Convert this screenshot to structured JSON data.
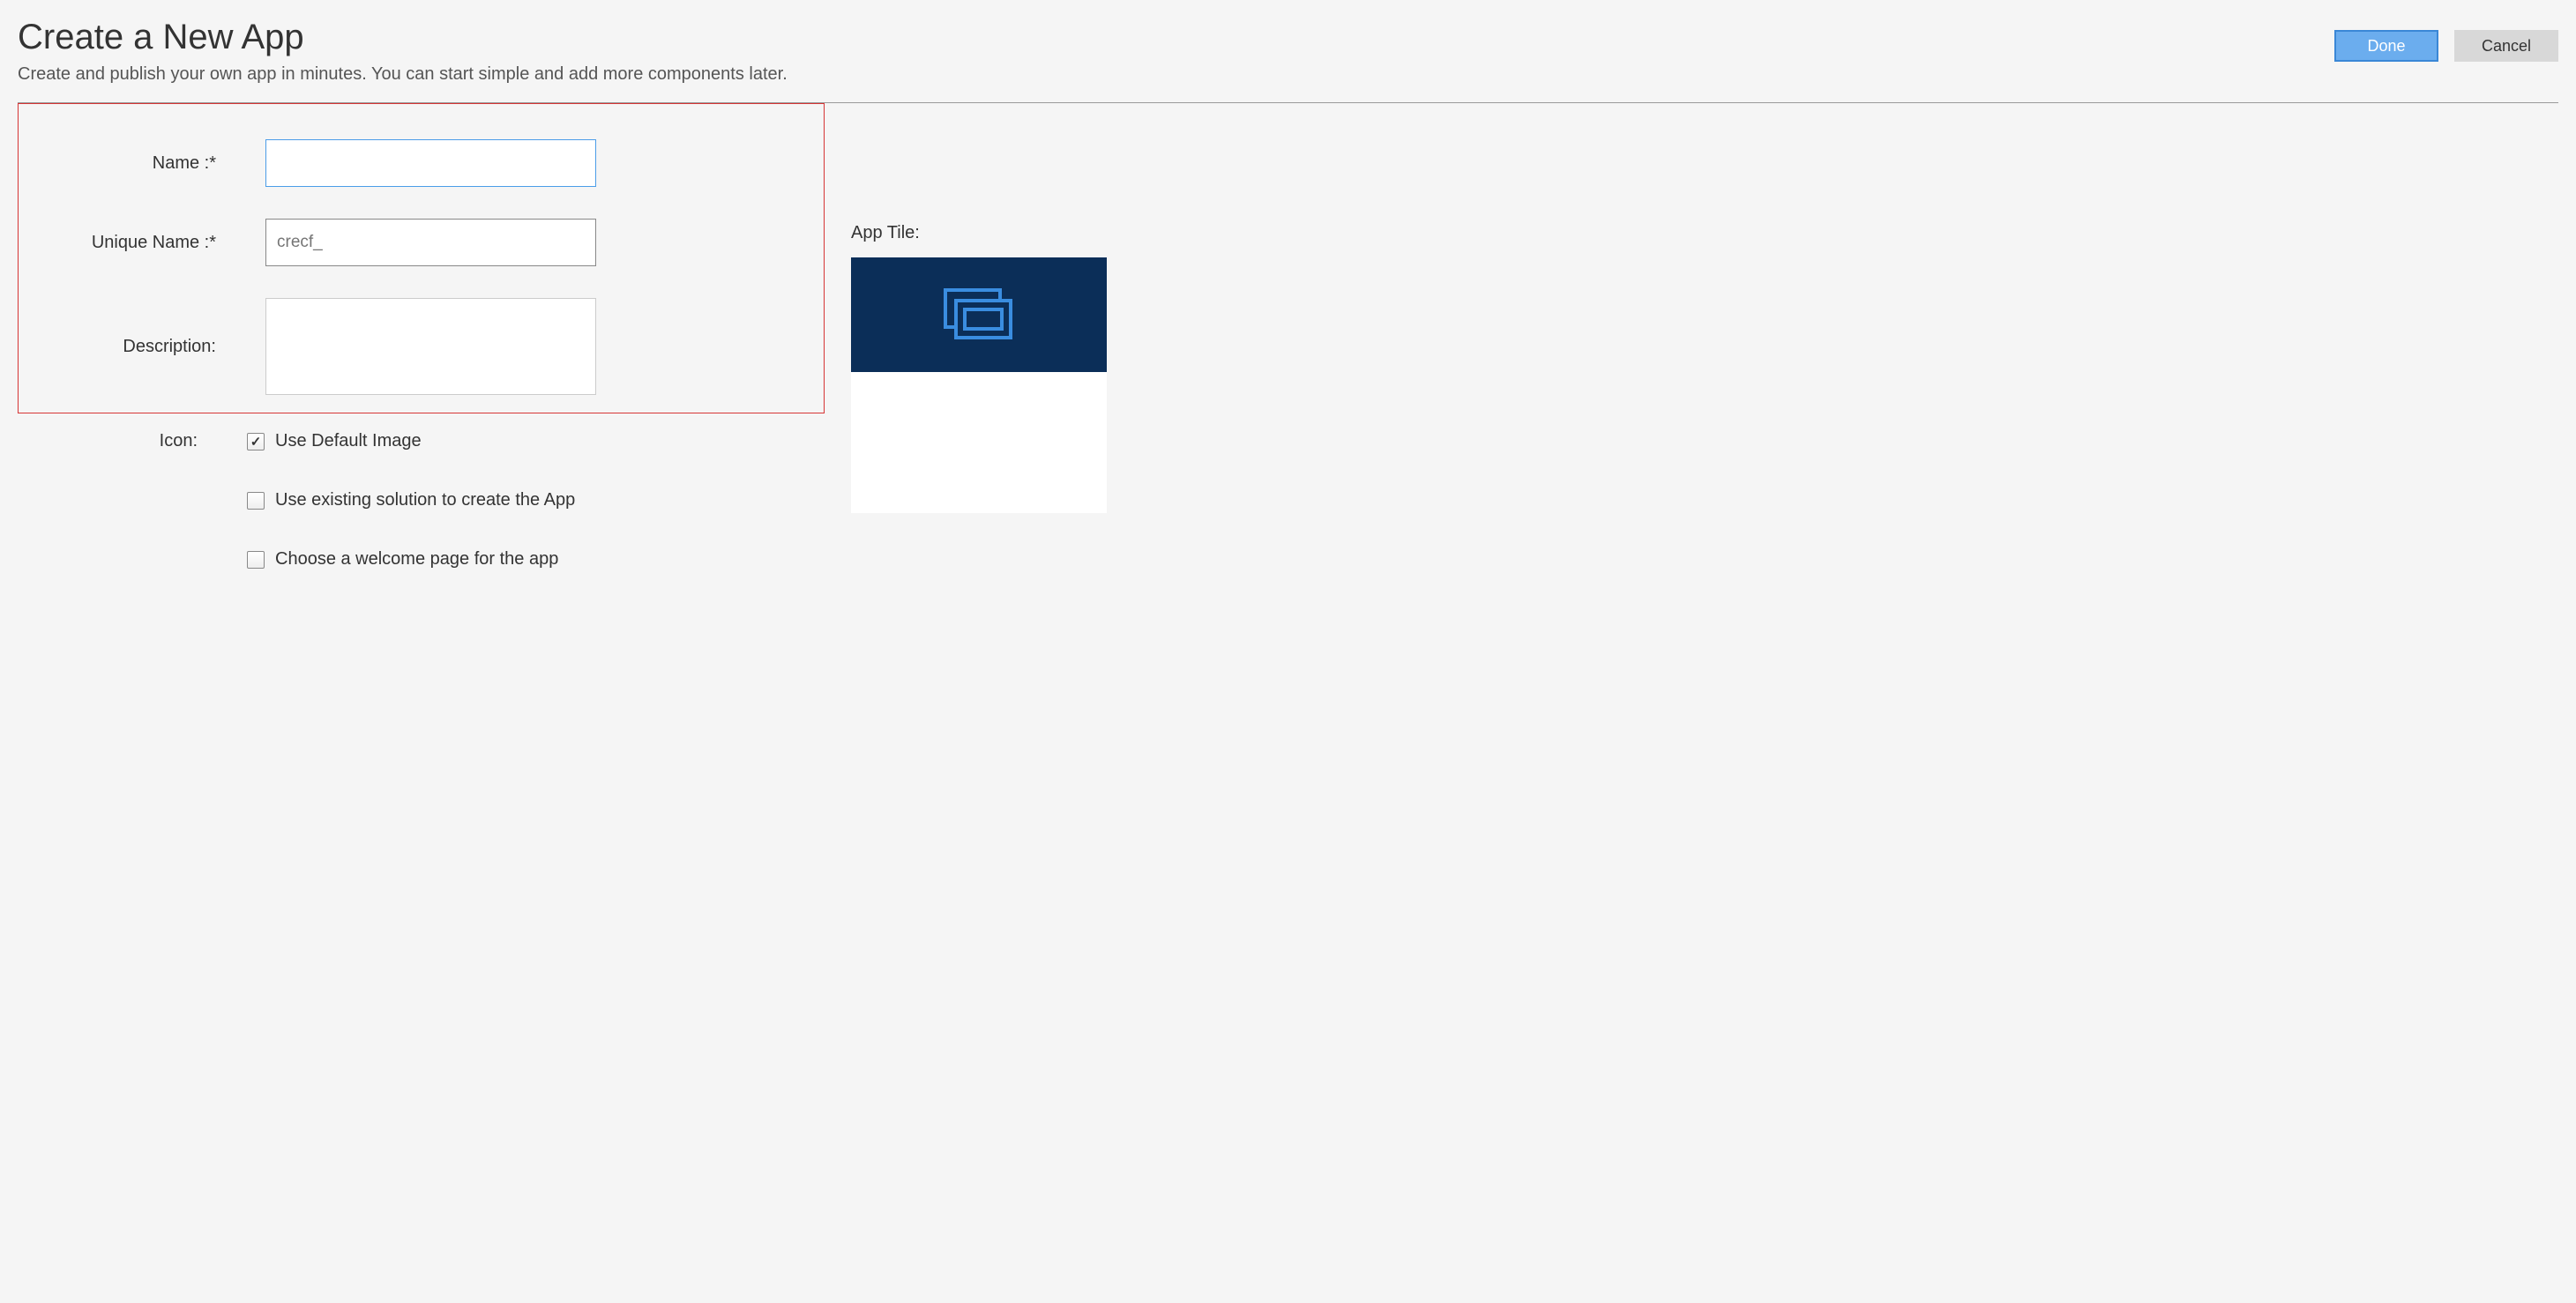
{
  "header": {
    "title": "Create a New App",
    "subtitle": "Create and publish your own app in minutes. You can start simple and add more components later."
  },
  "buttons": {
    "done": "Done",
    "cancel": "Cancel"
  },
  "form": {
    "name_label": "Name :*",
    "name_value": "",
    "unique_name_label": "Unique Name :*",
    "unique_name_placeholder": "crecf_",
    "description_label": "Description:",
    "description_value": "",
    "icon_label": "Icon:",
    "use_default_image_label": "Use Default Image",
    "use_default_image_checked": true,
    "use_existing_solution_label": "Use existing solution to create the App",
    "use_existing_solution_checked": false,
    "choose_welcome_label": "Choose a welcome page for the app",
    "choose_welcome_checked": false
  },
  "preview": {
    "label": "App Tile:",
    "tile_bg_color": "#0b2e58",
    "tile_icon_color": "#3a8de0"
  }
}
